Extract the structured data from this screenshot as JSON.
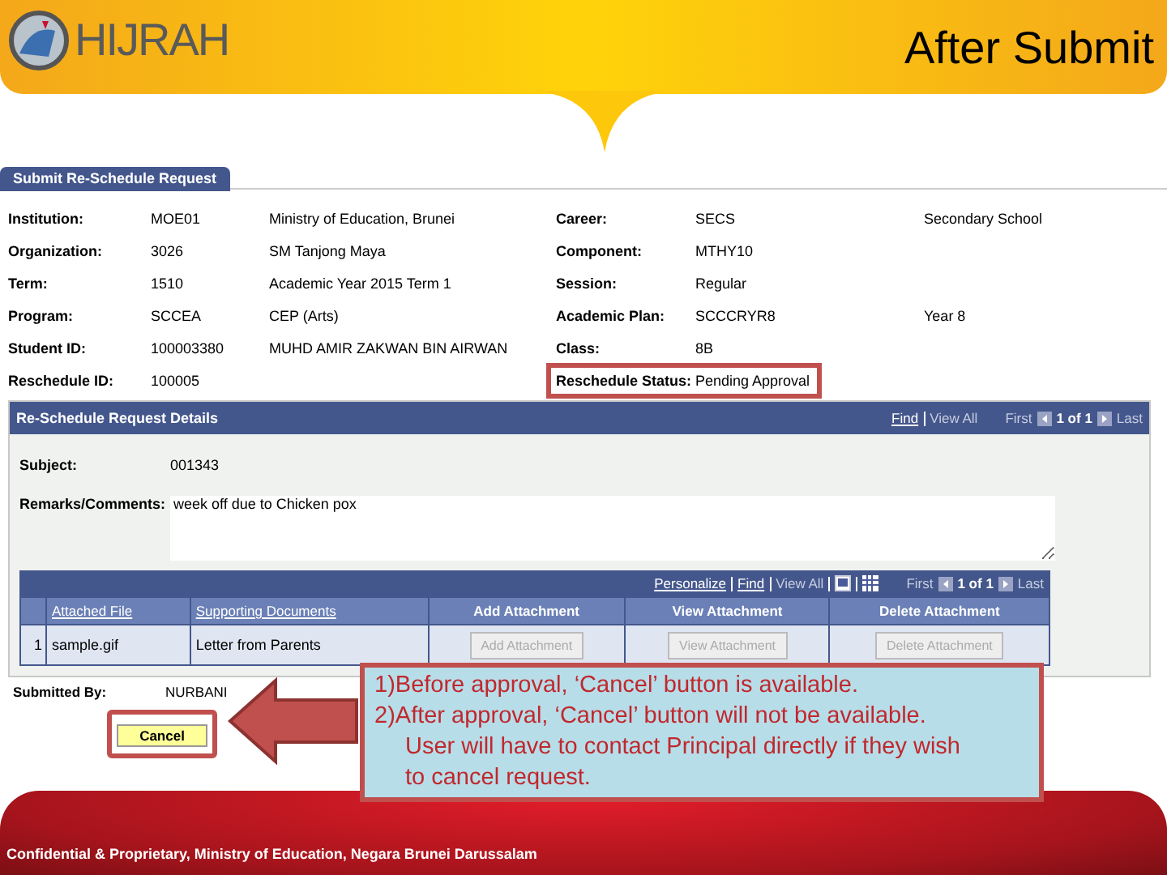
{
  "header": {
    "logo_text": "HIJRAH",
    "title": "After Submit"
  },
  "page_tab": {
    "label": "Submit Re-Schedule Request",
    "selected": true
  },
  "info_rows": [
    {
      "label": "Institution:",
      "value": "MOE01",
      "description": "Ministry of Education, Brunei",
      "label_2": "Career:",
      "value_2": "SECS",
      "description_2": "Secondary School",
      "highlighted": false
    },
    {
      "label": "Organization:",
      "value": "3026",
      "description": "SM Tanjong Maya",
      "label_2": "Component:",
      "value_2": "MTHY10",
      "highlighted": false
    },
    {
      "label": "Term:",
      "value": "1510",
      "description": "Academic Year 2015 Term 1",
      "label_2": "Session:",
      "value_2": "Regular",
      "highlighted": false
    },
    {
      "label": "Program:",
      "value": "SCCEA",
      "description": "CEP (Arts)",
      "label_2": "Academic Plan:",
      "value_2": "SCCCRYR8",
      "description_2": "Year 8",
      "highlighted": false
    },
    {
      "label": "Student ID:",
      "value": "100003380",
      "description": "MUHD AMIR ZAKWAN BIN AIRWAN",
      "label_2": "Class:",
      "value_2": "8B",
      "highlighted": false
    },
    {
      "label": "Reschedule ID:",
      "value": "100005",
      "label_2": "Reschedule Status:",
      "value_2": "Pending Approval",
      "highlighted": true
    }
  ],
  "details": {
    "title": "Re-Schedule Request Details",
    "nav": {
      "find": "Find",
      "view_all": "View All",
      "first": "First",
      "count": "1 of 1",
      "last": "Last"
    },
    "subject_label": "Subject:",
    "subject": "001343",
    "remarks_label": "Remarks/Comments:",
    "remarks": "week off due to Chicken pox"
  },
  "attachments": {
    "nav": {
      "personalize": "Personalize",
      "find": "Find",
      "view_all": "View All",
      "first": "First",
      "count": "1 of 1",
      "last": "Last"
    },
    "columns": [
      {
        "label": "Attached File",
        "kind": "link"
      },
      {
        "label": "Supporting Documents",
        "kind": "link"
      },
      {
        "label": "Add Attachment",
        "kind": "plain"
      },
      {
        "label": "View Attachment",
        "kind": "plain"
      },
      {
        "label": "Delete Attachment",
        "kind": "plain"
      }
    ],
    "rows": [
      {
        "index": "1",
        "file": "sample.gif",
        "document": "Letter from Parents",
        "actions": [
          {
            "label": "Add Attachment",
            "disabled": true
          },
          {
            "label": "View Attachment",
            "disabled": true
          },
          {
            "label": "Delete Attachment",
            "disabled": true
          }
        ]
      }
    ]
  },
  "submitted_by": {
    "label": "Submitted By:",
    "value": "NURBANI"
  },
  "cancel_button": {
    "label": "Cancel",
    "highlighted": true
  },
  "callout": {
    "items": [
      {
        "text": "1)Before approval, ‘Cancel’ button is available."
      },
      {
        "text": "2)After approval, ‘Cancel’ button will not be available.",
        "note": "User will have to contact Principal directly if they wish to cancel request."
      }
    ]
  },
  "footer": {
    "text": "Confidential & Proprietary, Ministry of Education, Negara Brunei Darussalam"
  }
}
